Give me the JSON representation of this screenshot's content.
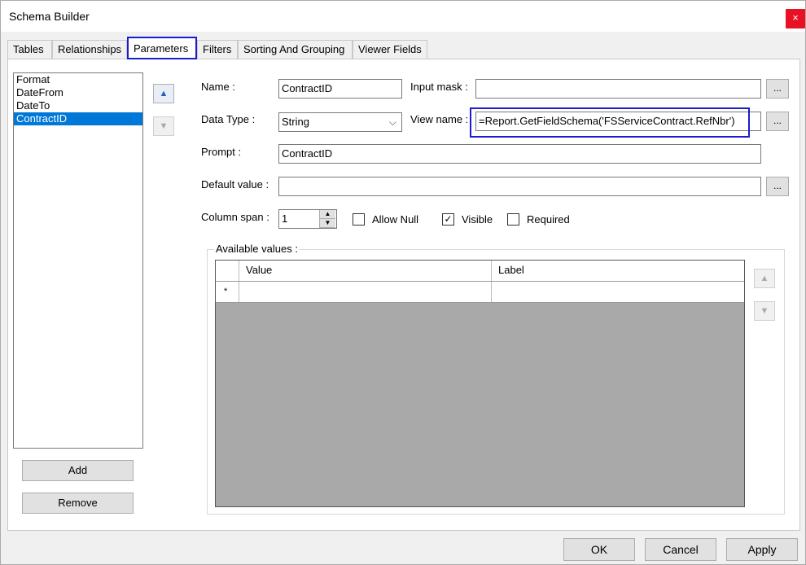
{
  "window": {
    "title": "Schema Builder",
    "close_glyph": "×"
  },
  "tabs": [
    {
      "label": "Tables"
    },
    {
      "label": "Relationships"
    },
    {
      "label": "Parameters",
      "active": true
    },
    {
      "label": "Filters"
    },
    {
      "label": "Sorting And Grouping"
    },
    {
      "label": "Viewer Fields"
    }
  ],
  "parameters_list": {
    "items": [
      "Format",
      "DateFrom",
      "DateTo",
      "ContractID"
    ],
    "selected": "ContractID"
  },
  "list_buttons": {
    "add": "Add",
    "remove": "Remove",
    "move_up_icon": "up-arrow-icon",
    "move_down_icon": "down-arrow-icon"
  },
  "form": {
    "name_label": "Name :",
    "name_value": "ContractID",
    "input_mask_label": "Input mask :",
    "input_mask_value": "",
    "data_type_label": "Data Type :",
    "data_type_value": "String",
    "view_name_label": "View name :",
    "view_name_value": "=Report.GetFieldSchema('FSServiceContract.RefNbr')",
    "prompt_label": "Prompt :",
    "prompt_value": "ContractID",
    "default_value_label": "Default value :",
    "default_value_value": "",
    "column_span_label": "Column span :",
    "column_span_value": "1",
    "allow_null_label": "Allow Null",
    "allow_null_checked": false,
    "visible_label": "Visible",
    "visible_checked": true,
    "required_label": "Required",
    "required_checked": false,
    "ellipsis": "..."
  },
  "available_values": {
    "title": "Available values :",
    "columns": [
      "Value",
      "Label"
    ],
    "new_row_marker": "*"
  },
  "footer": {
    "ok": "OK",
    "cancel": "Cancel",
    "apply": "Apply"
  },
  "colors": {
    "accent_highlight": "#1b1bd0",
    "selection": "#0078d7",
    "close": "#e81123"
  }
}
